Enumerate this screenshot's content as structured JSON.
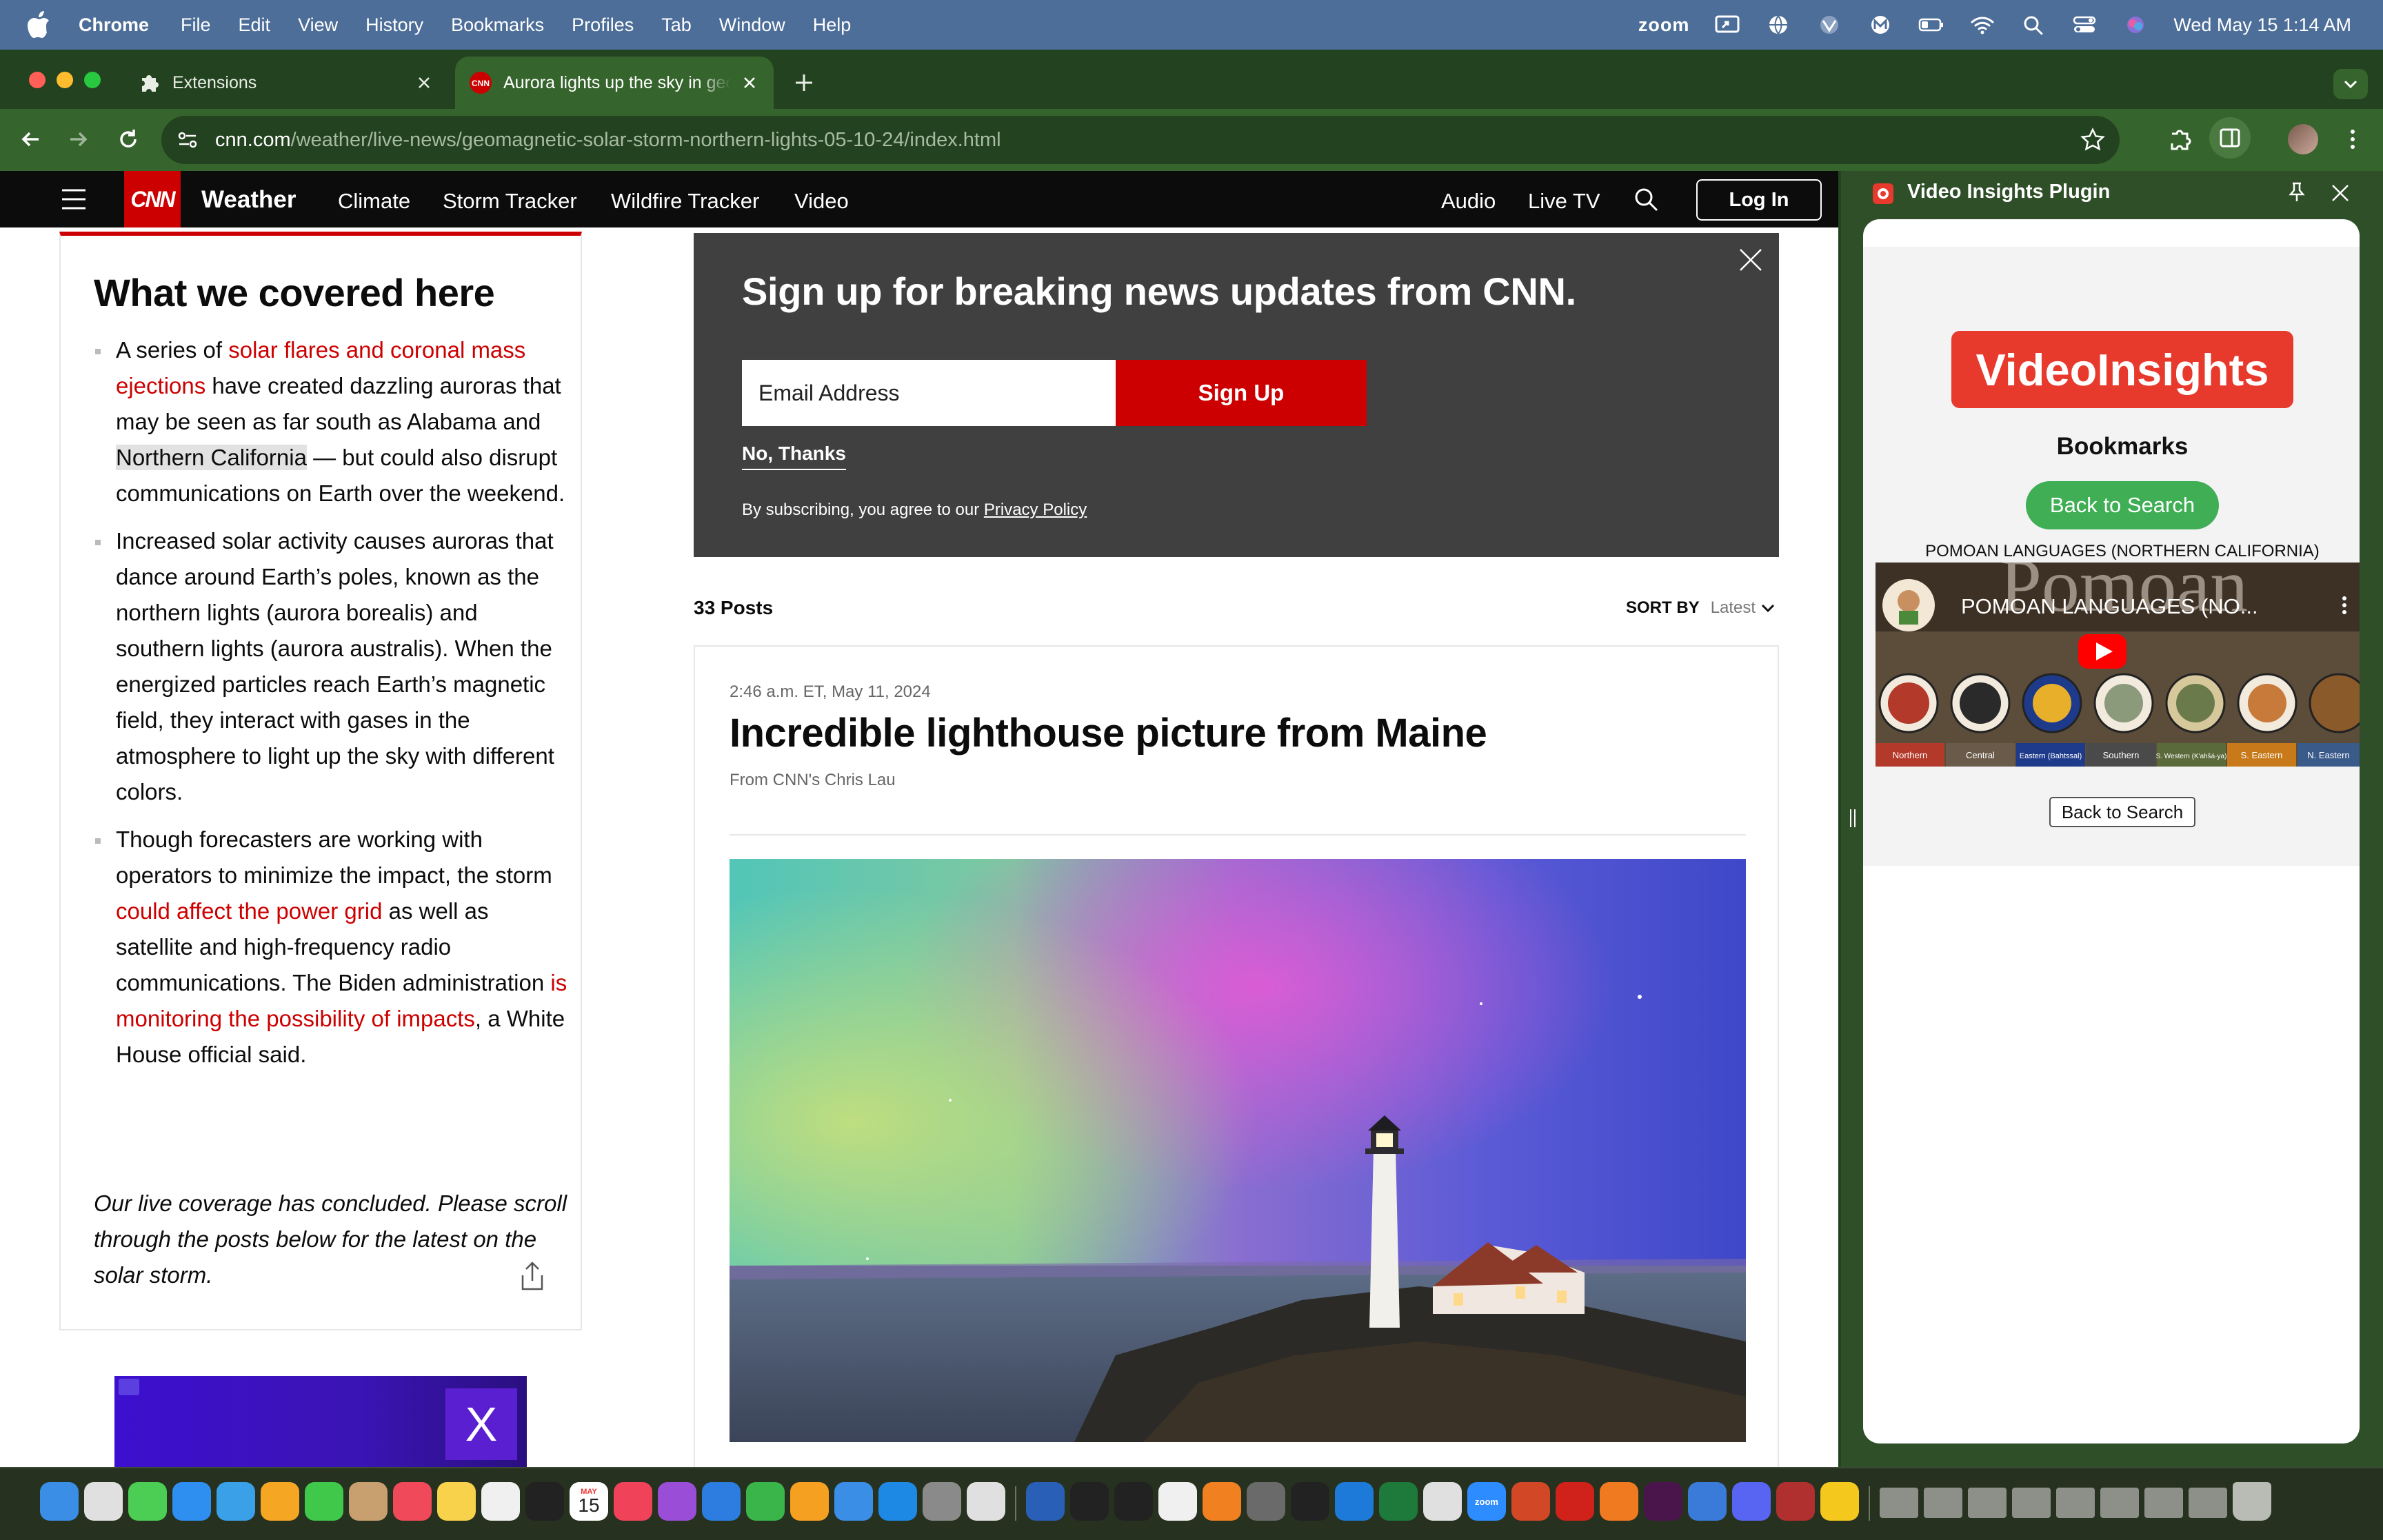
{
  "menubar": {
    "app_name": "Chrome",
    "items": [
      "File",
      "Edit",
      "View",
      "History",
      "Bookmarks",
      "Profiles",
      "Tab",
      "Window",
      "Help"
    ],
    "zoom_label": "zoom",
    "status_icons": [
      "screen-share-icon",
      "globe-icon",
      "vpn-icon",
      "malwarebytes-icon",
      "battery-icon",
      "wifi-icon",
      "spotlight-search-icon",
      "control-center-icon",
      "siri-icon"
    ],
    "clock": "Wed May 15  1:14 AM"
  },
  "tabs": [
    {
      "title": "Extensions",
      "icon": "puzzle-icon",
      "active": false
    },
    {
      "title": "Aurora lights up the sky in geo",
      "icon": "cnn-favicon-icon",
      "active": true
    }
  ],
  "omnibox": {
    "domain": "cnn.com",
    "path": "/weather/live-news/geomagnetic-solar-storm-northern-lights-05-10-24/index.html"
  },
  "cnn_nav": {
    "logo": "CNN",
    "section": "Weather",
    "links": [
      "Climate",
      "Storm Tracker",
      "Wildfire Tracker",
      "Video"
    ],
    "right_links": [
      "Audio",
      "Live TV"
    ],
    "login": "Log In"
  },
  "covered": {
    "heading": "What we covered here",
    "bullets": [
      {
        "pre": "A series of ",
        "link": "solar flares and coronal mass ejections",
        "mid": " have created dazzling auroras that may be seen as far south as Alabama and ",
        "highlight": "Northern California",
        "post": " — but could also disrupt communications on Earth over the weekend."
      },
      {
        "text": "Increased solar activity causes auroras that dance around Earth’s poles, known as the northern lights (aurora borealis) and southern lights (aurora australis). When the energized particles reach Earth’s magnetic field, they interact with gases in the atmosphere to light up the sky with different colors."
      },
      {
        "pre": "Though forecasters are working with operators to minimize the impact, the storm ",
        "link": "could affect the power grid",
        "mid": " as well as satellite and high-frequency radio communications. The Biden administration ",
        "link2": "is monitoring the possibility of impacts",
        "post": ", a White House official said."
      }
    ],
    "closing": "Our live coverage has concluded. Please scroll through the posts below for the latest on the solar storm."
  },
  "signup": {
    "heading": "Sign up for breaking news updates from CNN.",
    "email_placeholder": "Email Address",
    "button": "Sign Up",
    "decline": "No, Thanks",
    "policy_text": "By subscribing, you agree to our ",
    "policy_link": "Privacy Policy"
  },
  "posts": {
    "count": "33 Posts",
    "sort_label": "SORT BY",
    "sort_value": "Latest"
  },
  "post": {
    "time": "2:46 a.m. ET, May 11, 2024",
    "headline": "Incredible lighthouse picture from Maine",
    "byline": "From CNN's Chris Lau"
  },
  "side_panel": {
    "title": "Video Insights Plugin",
    "logo": "VideoInsights",
    "bookmarks_heading": "Bookmarks",
    "back_button": "Back to Search",
    "video_caption": "POMOAN LANGUAGES (NORTHERN CALIFORNIA)",
    "video_title": "POMOAN LANGUAGES (NO...",
    "video_bg_word": "Pomoan",
    "video_regions": [
      "Northern",
      "Central",
      "Eastern (Bahtssal)",
      "Southern",
      "S. Western (K'ahšá·ya)",
      "S. Eastern",
      "N. Eastern"
    ],
    "back_button_plain": "Back to Search"
  },
  "dock": {
    "apps": [
      "finder-icon",
      "launchpad-icon",
      "messages-icon",
      "safari-icon",
      "maps-icon",
      "photos-icon",
      "facetime-icon",
      "contacts-icon",
      "news-icon",
      "notes-icon",
      "reminders-icon",
      "tv-icon",
      "calendar-icon",
      "music-icon",
      "podcasts-icon",
      "keynote-icon",
      "numbers-icon",
      "pages-icon",
      "mail-icon",
      "app-store-icon",
      "system-settings-icon",
      "roblox-icon",
      "word-icon",
      "activity-monitor-icon",
      "terminal-icon",
      "textedit-icon",
      "sublime-icon",
      "texshop-icon",
      "unity-icon",
      "vscode-icon",
      "excel-icon",
      "preview-icon",
      "zoom-icon",
      "powerpoint-icon",
      "acrobat-icon",
      "firefox-icon",
      "slack-icon",
      "screen-sharing-icon",
      "discord-icon",
      "dictionary-icon",
      "chrome-icon"
    ],
    "calendar_month": "MAY",
    "calendar_day": "15",
    "zoom_dock_label": "zoom",
    "recent_items": [
      "recent-window-1",
      "recent-window-2",
      "recent-window-3",
      "recent-window-4",
      "recent-window-5",
      "recent-window-6",
      "recent-window-7",
      "recent-window-8"
    ],
    "trash": "trash-icon"
  }
}
